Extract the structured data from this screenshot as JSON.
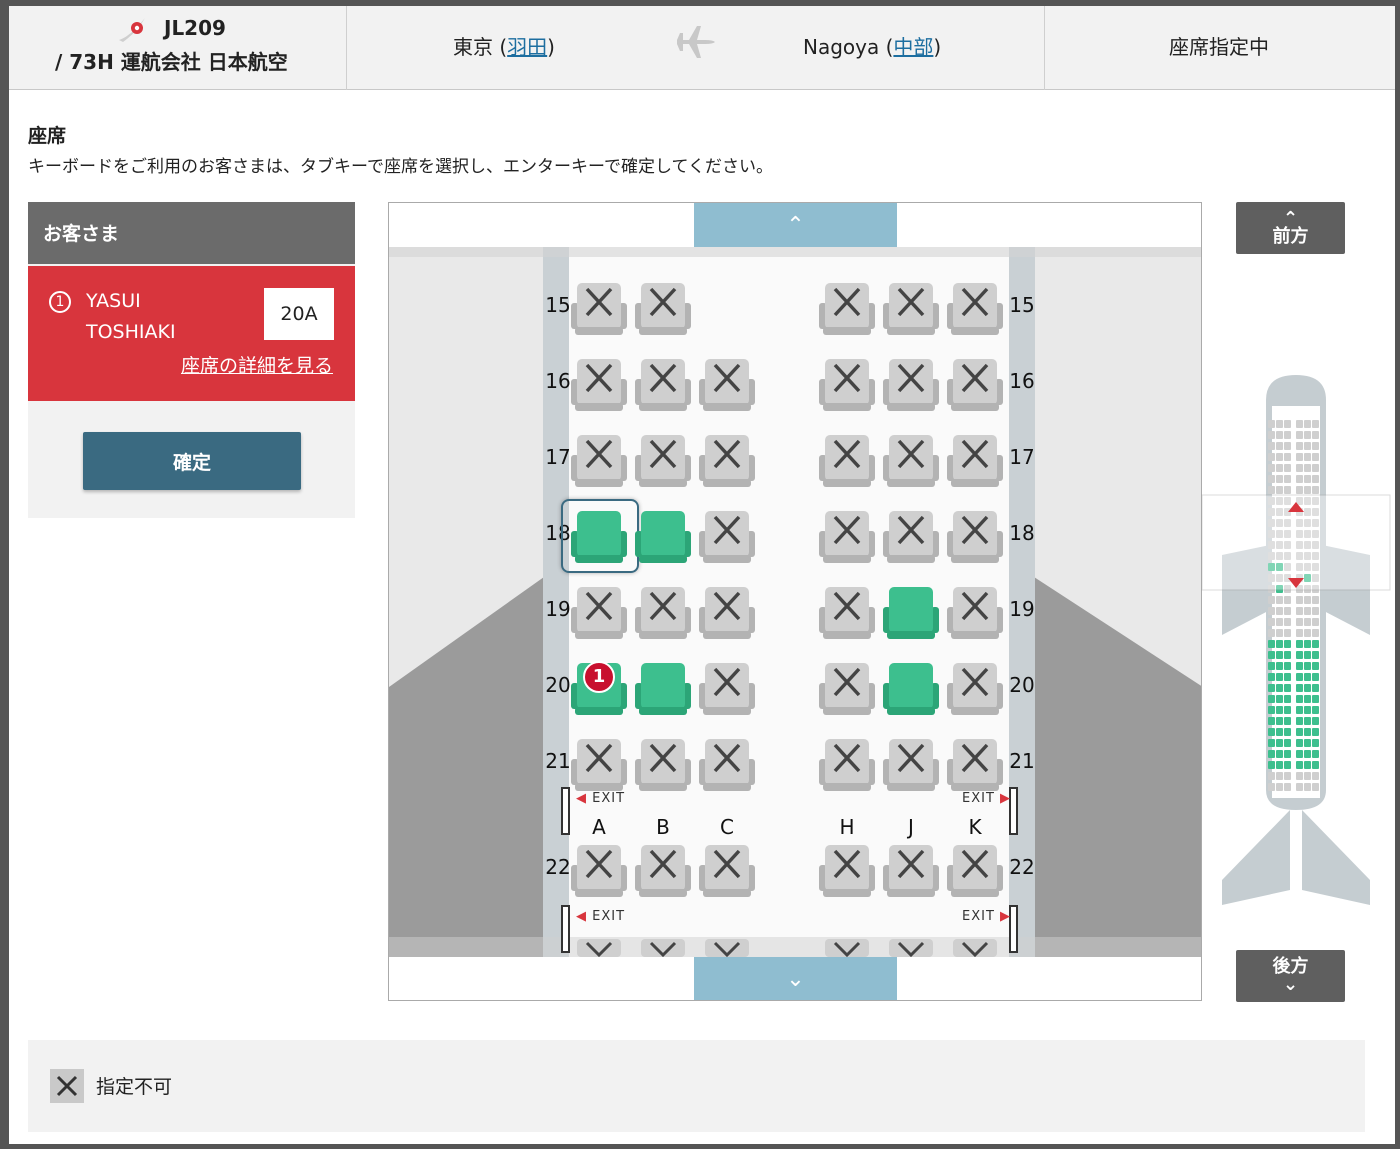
{
  "header": {
    "flight_number": "JL209",
    "flight_operator": "/ 73H 運航会社 日本航空",
    "from_city": "東京 (",
    "from_airport": "羽田",
    "from_close": ")",
    "to_city": "Nagoya (",
    "to_airport": "中部",
    "to_close": ")",
    "status": "座席指定中"
  },
  "section": {
    "title": "座席",
    "description": "キーボードをご利用のお客さまは、タブキーで座席を選択し、エンターキーで確定してください。"
  },
  "passenger_panel": {
    "heading": "お客さま",
    "number": "1",
    "first_line": "YASUI",
    "second_line": "TOSHIAKI",
    "seat": "20A",
    "detail_link": "座席の詳細を見る",
    "confirm_label": "確定"
  },
  "nav": {
    "forward_label": "前方",
    "back_label": "後方"
  },
  "seatmap": {
    "left_columns": [
      "A",
      "B",
      "C"
    ],
    "right_columns": [
      "H",
      "J",
      "K"
    ],
    "exit_label": "EXIT",
    "rows": [
      {
        "row": "15",
        "seats": {
          "A": "unavailable",
          "B": "unavailable",
          "C": "none",
          "H": "unavailable",
          "J": "unavailable",
          "K": "unavailable"
        }
      },
      {
        "row": "16",
        "seats": {
          "A": "unavailable",
          "B": "unavailable",
          "C": "unavailable",
          "H": "unavailable",
          "J": "unavailable",
          "K": "unavailable"
        }
      },
      {
        "row": "17",
        "seats": {
          "A": "unavailable",
          "B": "unavailable",
          "C": "unavailable",
          "H": "unavailable",
          "J": "unavailable",
          "K": "unavailable"
        }
      },
      {
        "row": "18",
        "seats": {
          "A": "available",
          "B": "available",
          "C": "unavailable",
          "H": "unavailable",
          "J": "unavailable",
          "K": "unavailable"
        }
      },
      {
        "row": "19",
        "seats": {
          "A": "unavailable",
          "B": "unavailable",
          "C": "unavailable",
          "H": "unavailable",
          "J": "available",
          "K": "unavailable"
        }
      },
      {
        "row": "20",
        "seats": {
          "A": "selected",
          "B": "available",
          "C": "unavailable",
          "H": "unavailable",
          "J": "available",
          "K": "unavailable"
        }
      },
      {
        "row": "21",
        "seats": {
          "A": "unavailable",
          "B": "unavailable",
          "C": "unavailable",
          "H": "unavailable",
          "J": "unavailable",
          "K": "unavailable"
        }
      },
      {
        "row": "22",
        "seats": {
          "A": "unavailable",
          "B": "unavailable",
          "C": "unavailable",
          "H": "unavailable",
          "J": "unavailable",
          "K": "unavailable"
        }
      }
    ],
    "focused_seat": "18A",
    "selected_marker": "1"
  },
  "legend": {
    "unavailable_label": "指定不可"
  },
  "colors": {
    "accent_red": "#d8353d",
    "available_green": "#3dbf8e",
    "unavailable_grey": "#cfcfcf",
    "button_blue": "#3a6a81",
    "scroll_blue": "#8fbdd0"
  }
}
